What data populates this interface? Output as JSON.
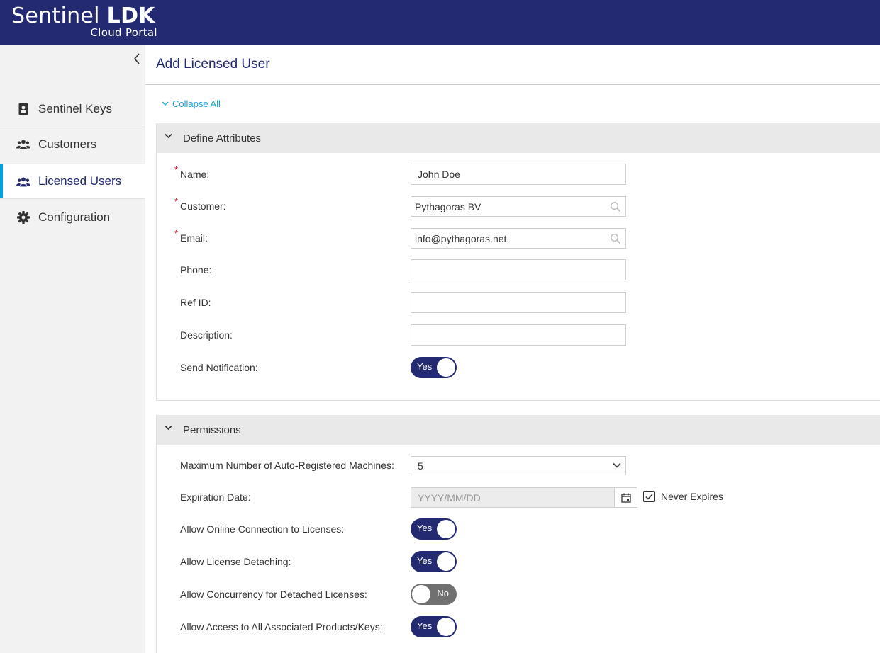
{
  "brand": {
    "name_light": "Sentinel",
    "name_bold": "LDK",
    "subtitle": "Cloud Portal"
  },
  "sidebar": {
    "collapse_icon": "chevron-left-icon",
    "items": [
      {
        "label": "Sentinel Keys",
        "icon": "badge-icon",
        "active": false
      },
      {
        "label": "Customers",
        "icon": "users-icon",
        "active": false
      },
      {
        "label": "Licensed Users",
        "icon": "users-icon",
        "active": true
      },
      {
        "label": "Configuration",
        "icon": "gear-icon",
        "active": false
      }
    ]
  },
  "main": {
    "title": "Add Licensed User",
    "collapse_all": "Collapse All",
    "define": {
      "title": "Define Attributes",
      "name_label": "Name:",
      "name_value": "John Doe",
      "customer_label": "Customer:",
      "customer_value": "Pythagoras BV",
      "email_label": "Email:",
      "email_value": "info@pythagoras.net",
      "phone_label": "Phone:",
      "phone_value": "",
      "refid_label": "Ref ID:",
      "refid_value": "",
      "description_label": "Description:",
      "description_value": "",
      "notify_label": "Send Notification:",
      "notify_state": "Yes"
    },
    "permissions": {
      "title": "Permissions",
      "max_machines_label": "Maximum Number of Auto-Registered Machines:",
      "max_machines_value": "5",
      "expiration_label": "Expiration Date:",
      "expiration_placeholder": "YYYY/MM/DD",
      "never_expires_label": "Never Expires",
      "never_expires_checked": true,
      "online_label": "Allow Online Connection to Licenses:",
      "online_state": "Yes",
      "detach_label": "Allow License Detaching:",
      "detach_state": "Yes",
      "concurrency_label": "Allow Concurrency for Detached Licenses:",
      "concurrency_state": "No",
      "access_label": "Allow Access to All Associated Products/Keys:",
      "access_state": "Yes"
    }
  },
  "colors": {
    "header": "#232a72",
    "accent": "#00a3d9",
    "required": "#d0021b",
    "toggle_on": "#232a72",
    "toggle_off": "#707070"
  }
}
